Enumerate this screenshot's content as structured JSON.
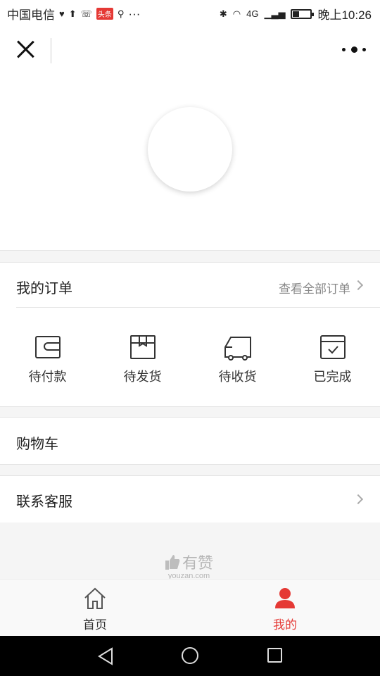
{
  "status_bar": {
    "carrier": "中国电信",
    "news_badge": "头条",
    "more": "···",
    "network": "4G",
    "time": "晚上10:26"
  },
  "orders": {
    "title": "我的订单",
    "view_all": "查看全部订单",
    "items": [
      {
        "label": "待付款",
        "icon": "wallet-icon"
      },
      {
        "label": "待发货",
        "icon": "package-icon"
      },
      {
        "label": "待收货",
        "icon": "truck-icon"
      },
      {
        "label": "已完成",
        "icon": "calendar-check-icon"
      }
    ]
  },
  "cart": {
    "label": "购物车"
  },
  "service": {
    "label": "联系客服"
  },
  "brand": {
    "name": "有赞",
    "domain": "youzan.com"
  },
  "tabbar": {
    "tabs": [
      {
        "label": "首页",
        "icon": "home-icon"
      },
      {
        "label": "我的",
        "icon": "user-icon",
        "active": true
      }
    ]
  },
  "colors": {
    "accent": "#e53935",
    "background": "#f5f5f5"
  }
}
